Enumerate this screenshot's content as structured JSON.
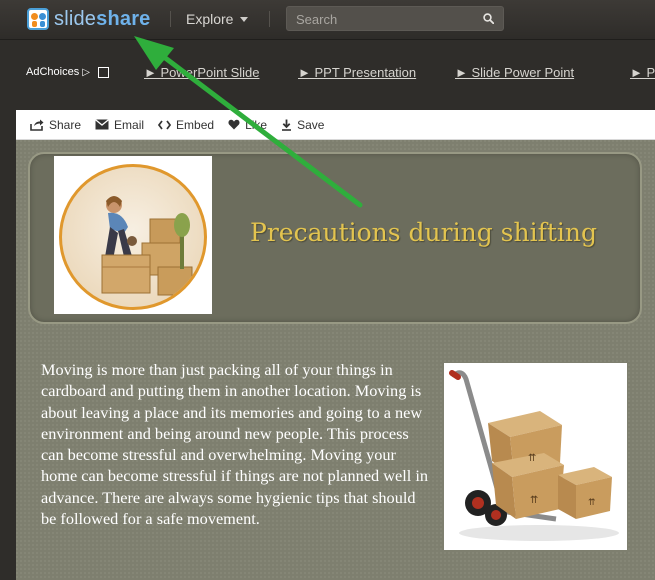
{
  "header": {
    "logo_light": "slide",
    "logo_bold": "share",
    "explore_label": "Explore",
    "search_placeholder": "Search"
  },
  "ads": {
    "adchoices_label": "AdChoices",
    "links": [
      "► PowerPoint Slide",
      "► PPT Presentation",
      "► Slide Power Point",
      "► P"
    ]
  },
  "toolbar": {
    "share_label": "Share",
    "email_label": "Email",
    "embed_label": "Embed",
    "like_label": "Like",
    "save_label": "Save"
  },
  "slide": {
    "title": "Precautions during shifting",
    "body": "Moving is more than just packing all of your things in cardboard and putting them in another location. Moving is about leaving a place and its memories and going to a new environment and being around new people. This process can become stressful and overwhelming. Moving your home can become stressful if things are not planned well in advance. There are always some hygienic tips that should be followed for a safe movement."
  },
  "colors": {
    "topbar": "#2f2d2a",
    "logo_blue": "#6fb2ea",
    "slide_bg": "#7e7f6f",
    "title_gold": "#e3c44f",
    "arrow_green": "#2fae3c"
  }
}
